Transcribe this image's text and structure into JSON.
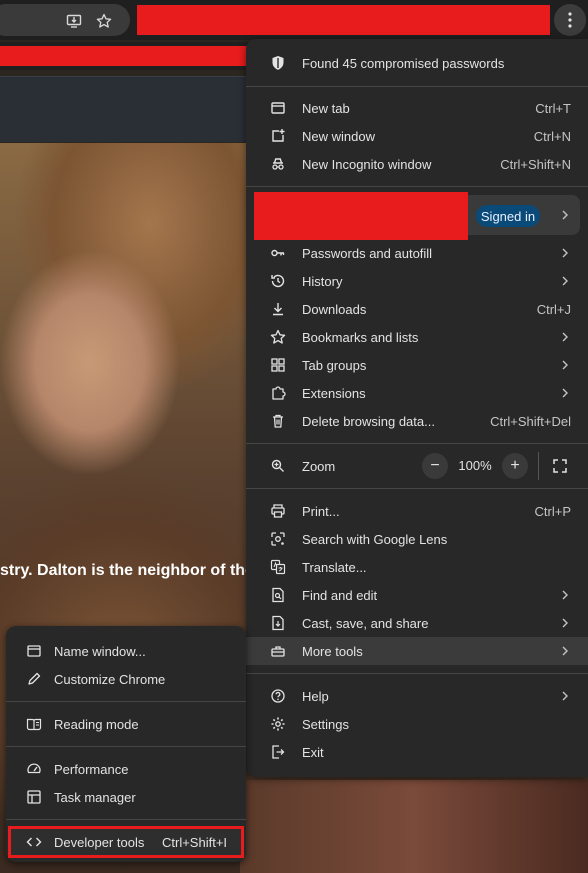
{
  "page": {
    "caption": "stry. Dalton is the neighbor of the y"
  },
  "menu": {
    "compromised": "Found 45 compromised passwords",
    "new_tab": {
      "label": "New tab",
      "shortcut": "Ctrl+T"
    },
    "new_window": {
      "label": "New window",
      "shortcut": "Ctrl+N"
    },
    "new_incognito": {
      "label": "New Incognito window",
      "shortcut": "Ctrl+Shift+N"
    },
    "profile": {
      "signed_in": "Signed in"
    },
    "passwords": "Passwords and autofill",
    "history": "History",
    "downloads": {
      "label": "Downloads",
      "shortcut": "Ctrl+J"
    },
    "bookmarks": "Bookmarks and lists",
    "tab_groups": "Tab groups",
    "extensions": "Extensions",
    "delete_data": {
      "label": "Delete browsing data...",
      "shortcut": "Ctrl+Shift+Del"
    },
    "zoom": {
      "label": "Zoom",
      "value": "100%",
      "minus": "−",
      "plus": "+"
    },
    "print": {
      "label": "Print...",
      "shortcut": "Ctrl+P"
    },
    "lens": "Search with Google Lens",
    "translate": "Translate...",
    "find_edit": "Find and edit",
    "cast": "Cast, save, and share",
    "more_tools": "More tools",
    "help": "Help",
    "settings": "Settings",
    "exit": "Exit"
  },
  "submenu": {
    "name_window": "Name window...",
    "customize": "Customize Chrome",
    "reading_mode": "Reading mode",
    "performance": "Performance",
    "task_manager": "Task manager",
    "devtools": {
      "label": "Developer tools",
      "shortcut": "Ctrl+Shift+I"
    }
  },
  "colors": {
    "redaction": "#e81c1c",
    "menu_bg": "#282828",
    "signed_in_bg": "#0a4a79"
  }
}
